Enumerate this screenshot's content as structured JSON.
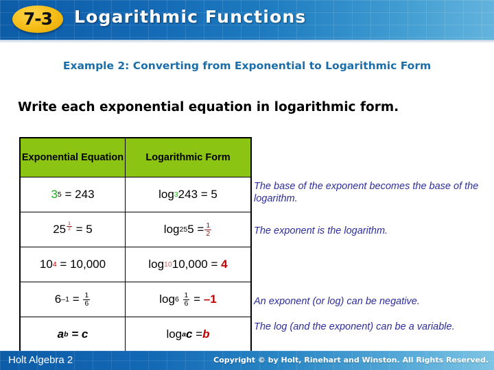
{
  "header": {
    "lesson_number": "7-3",
    "title": "Logarithmic Functions"
  },
  "example": {
    "title": "Example 2: Converting from Exponential to Logarithmic Form"
  },
  "instruction": "Write each exponential equation in logarithmic form.",
  "table": {
    "columns": [
      {
        "id": "exponential",
        "label": "Exponential Equation"
      },
      {
        "id": "logarithmic",
        "label": "Logarithmic Form"
      }
    ],
    "rows": [
      {
        "exponential_text": "3^5 = 243",
        "logarithmic_text": "log_3 243 = 5",
        "exp_base": "3",
        "exp_power": "5",
        "exp_result": "= 243",
        "log_word": "log",
        "log_base": "3",
        "log_arg": "243",
        "log_equals": "= 5"
      },
      {
        "exponential_text": "25^(1/2) = 5",
        "logarithmic_text": "log_25 5 = 1/2",
        "exp_base": "25",
        "exp_power_num": "1",
        "exp_power_den": "2",
        "exp_result": "= 5",
        "log_word": "log",
        "log_base": "25",
        "log_arg": "5",
        "log_equals": "=",
        "log_value_num": "1",
        "log_value_den": "2"
      },
      {
        "exponential_text": "10^4 = 10,000",
        "logarithmic_text": "log_10 10,000 = 4",
        "exp_base": "10",
        "exp_power": "4",
        "exp_result": "= 10,000",
        "log_word": "log",
        "log_base": "10",
        "log_arg": "10,000",
        "log_equals": "=",
        "log_value": "4"
      },
      {
        "exponential_text": "6^-1 = 1/6",
        "logarithmic_text": "log_6 1/6 = -1",
        "exp_base": "6",
        "exp_power": "–1",
        "exp_equals": "=",
        "exp_value_num": "1",
        "exp_value_den": "6",
        "log_word": "log",
        "log_base": "6",
        "log_arg_num": "1",
        "log_arg_den": "6",
        "log_equals": "=",
        "log_value": "–1"
      },
      {
        "exponential_text": "a^b = c",
        "logarithmic_text": "log_a c = b",
        "exp_base": "a",
        "exp_power": "b",
        "exp_result": "= c",
        "log_word": "log",
        "log_base": "a",
        "log_arg": "c",
        "log_equals": "=",
        "log_value": "b"
      }
    ]
  },
  "notes": [
    "The base of the exponent becomes the base of the logarithm.",
    "The exponent is the logarithm.",
    "An exponent (or log) can be negative.",
    "The log (and the exponent) can be a variable."
  ],
  "footer": {
    "book": "Holt Algebra 2",
    "copyright": "Copyright © by Holt, Rinehart and Winston. All Rights Reserved."
  },
  "colors": {
    "header_blue_dark": "#0d5ca8",
    "header_blue_light": "#63b4dd",
    "badge_yellow": "#f6bd18",
    "table_header_green": "#8cc413",
    "example_title_blue": "#1b6ea8",
    "note_navy": "#2d2d9e",
    "accent_green": "#18b018",
    "accent_red": "#c00000",
    "accent_darkred": "#8a1a1a"
  }
}
